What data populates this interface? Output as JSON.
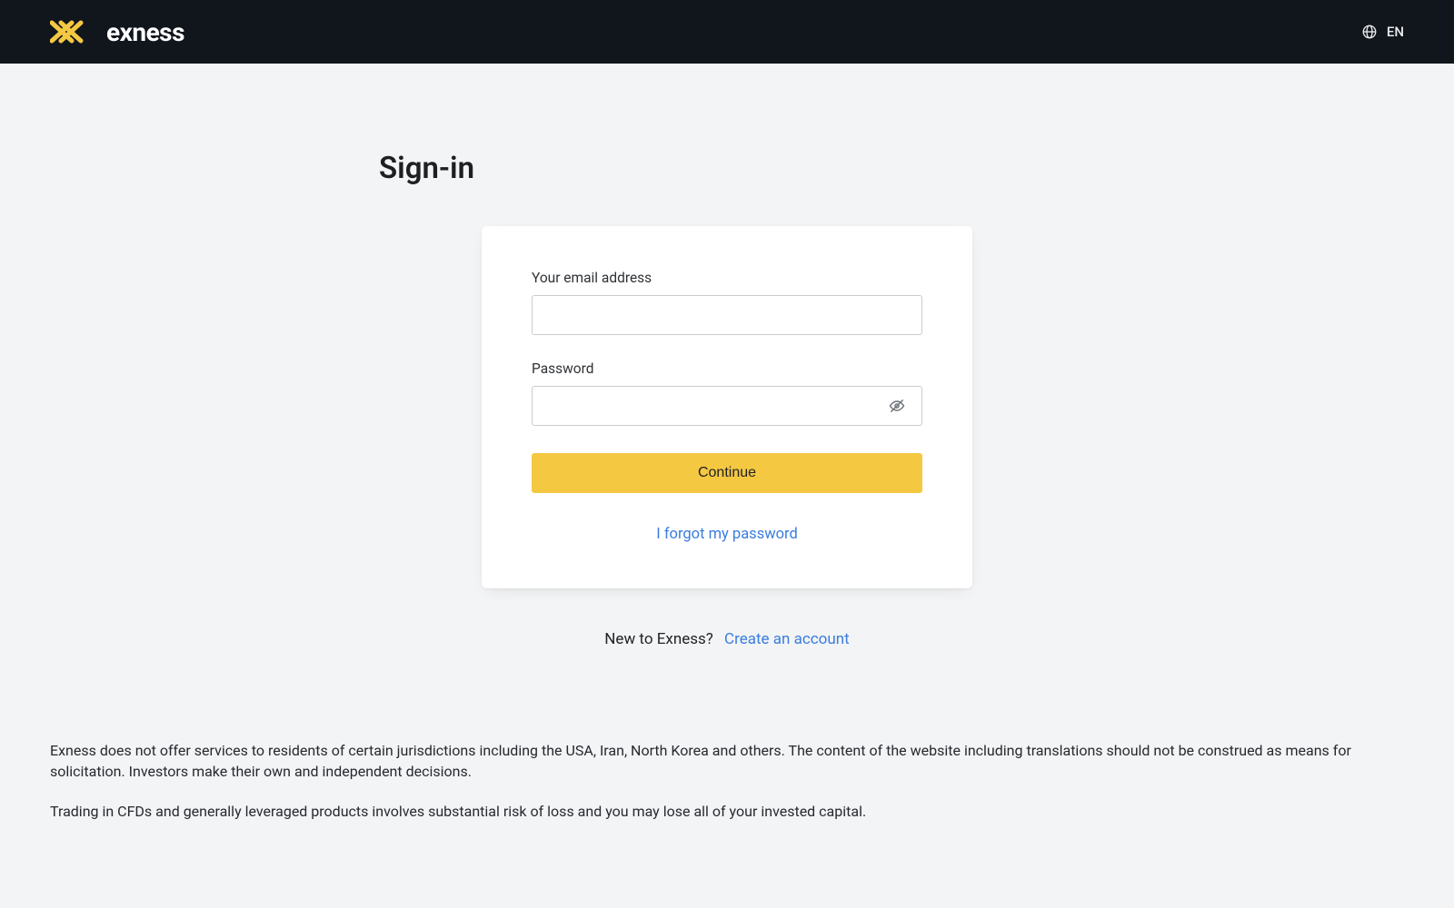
{
  "header": {
    "brand": "exness",
    "language_label": "EN"
  },
  "page": {
    "title": "Sign-in"
  },
  "form": {
    "email_label": "Your email address",
    "email_value": "",
    "password_label": "Password",
    "password_value": "",
    "continue_label": "Continue",
    "forgot_label": "I forgot my password"
  },
  "signup": {
    "prompt": "New to Exness?",
    "link_label": "Create an account"
  },
  "disclaimer": {
    "p1": "Exness does not offer services to residents of certain jurisdictions including the USA, Iran, North Korea and others. The content of the website including translations should not be construed as means for solicitation. Investors make their own and independent decisions.",
    "p2": "Trading in CFDs and generally leveraged products involves substantial risk of loss and you may lose all of your invested capital."
  },
  "colors": {
    "accent": "#f5c842",
    "link": "#3a7dde",
    "header_bg": "#11161d"
  }
}
